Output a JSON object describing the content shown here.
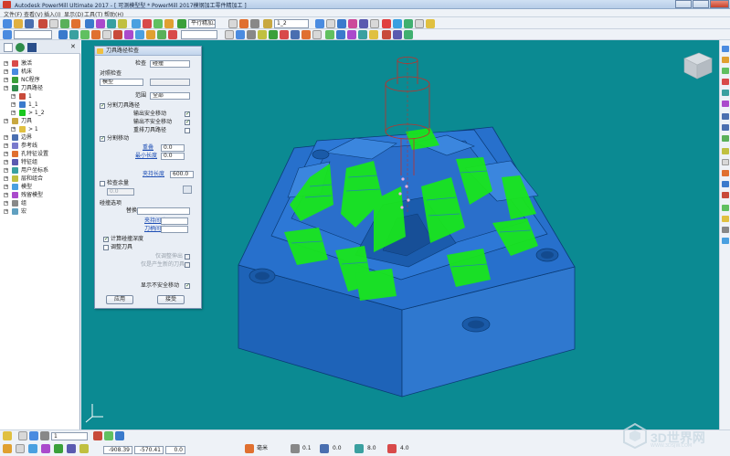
{
  "titlebar": {
    "title": "Autodesk PowerMill Ultimate 2017 - [ 可测模型型 * PowerMill 2017模钢加工零件精加工 ]"
  },
  "menubar": {
    "items": [
      "文件(F)",
      "查看(V)",
      "插入(I)",
      "显示(D)",
      "工具(T)",
      "帮助(H)"
    ]
  },
  "toolbar1": {
    "strategy_field": "平行精加工",
    "tool_field": "1_2"
  },
  "explorer": {
    "items": [
      {
        "label": "激活",
        "indent": 0
      },
      {
        "label": "机床",
        "indent": 0
      },
      {
        "label": "NC程序",
        "indent": 0
      },
      {
        "label": "刀具路径",
        "indent": 0
      },
      {
        "label": "1",
        "indent": 1
      },
      {
        "label": "1_1",
        "indent": 1
      },
      {
        "label": "> 1_2",
        "indent": 1
      },
      {
        "label": "刀具",
        "indent": 0
      },
      {
        "label": "> 1",
        "indent": 1
      },
      {
        "label": "边界",
        "indent": 0
      },
      {
        "label": "参考线",
        "indent": 0
      },
      {
        "label": "孔特征设置",
        "indent": 0
      },
      {
        "label": "特征组",
        "indent": 0
      },
      {
        "label": "用户坐标系",
        "indent": 0
      },
      {
        "label": "层和组合",
        "indent": 0
      },
      {
        "label": "模型",
        "indent": 0
      },
      {
        "label": "残留模型",
        "indent": 0
      },
      {
        "label": "组",
        "indent": 0
      },
      {
        "label": "宏",
        "indent": 0
      }
    ]
  },
  "dialog": {
    "title": "刀具路径检查",
    "check_label": "检查",
    "check_value": "碰撞",
    "against_label": "对照检查",
    "against_value": "模型",
    "scope_label": "范围",
    "scope_value": "全部",
    "split_label": "分割刀具路径",
    "out_safe_label": "输出安全移动",
    "out_unsafe_label": "输出不安全移动",
    "reorder_label": "重排刀具路径",
    "split_moves_label": "分割移动",
    "overlap_label": "重叠",
    "overlap_value": "0.0",
    "min_length_label": "最小长度",
    "min_length_value": "0.0",
    "holder_length_label": "夹持长度",
    "holder_length_value": "600.0",
    "check_stock_label": "检查余量",
    "stock_value": "0.0",
    "gouge_options_label": "碰撞选项",
    "replace_tool_label": "替换刀具",
    "clearance_label": "夹持间隙",
    "shank_clearance_label": "刀柄间隙",
    "calc_depth_label": "计算碰撞深度",
    "adjust_tool_label": "调整刀具",
    "holder_compliance_label": "仅调整伸出",
    "new_tool_label": "仅是产生新的刀具",
    "show_unsafe_label": "显示不安全移动",
    "apply_button": "应用",
    "accept_button": "接受"
  },
  "statusbar": {
    "coord_x": "-908.39",
    "coord_y": "-570.41",
    "coord_z": "0.0",
    "units": "毫米",
    "val1": "0.1",
    "val2": "0.0",
    "val3": "8.0",
    "val4": "4.0",
    "tool_field": "1"
  },
  "watermark": {
    "text": "3D世界网",
    "sub": "WWW.3DSJW.COM"
  },
  "colors": {
    "viewport_bg": "#0b8a92",
    "part_blue": "#1f6fd0",
    "toolpath_green": "#19e51e",
    "tool_outline": "#c0302a"
  }
}
